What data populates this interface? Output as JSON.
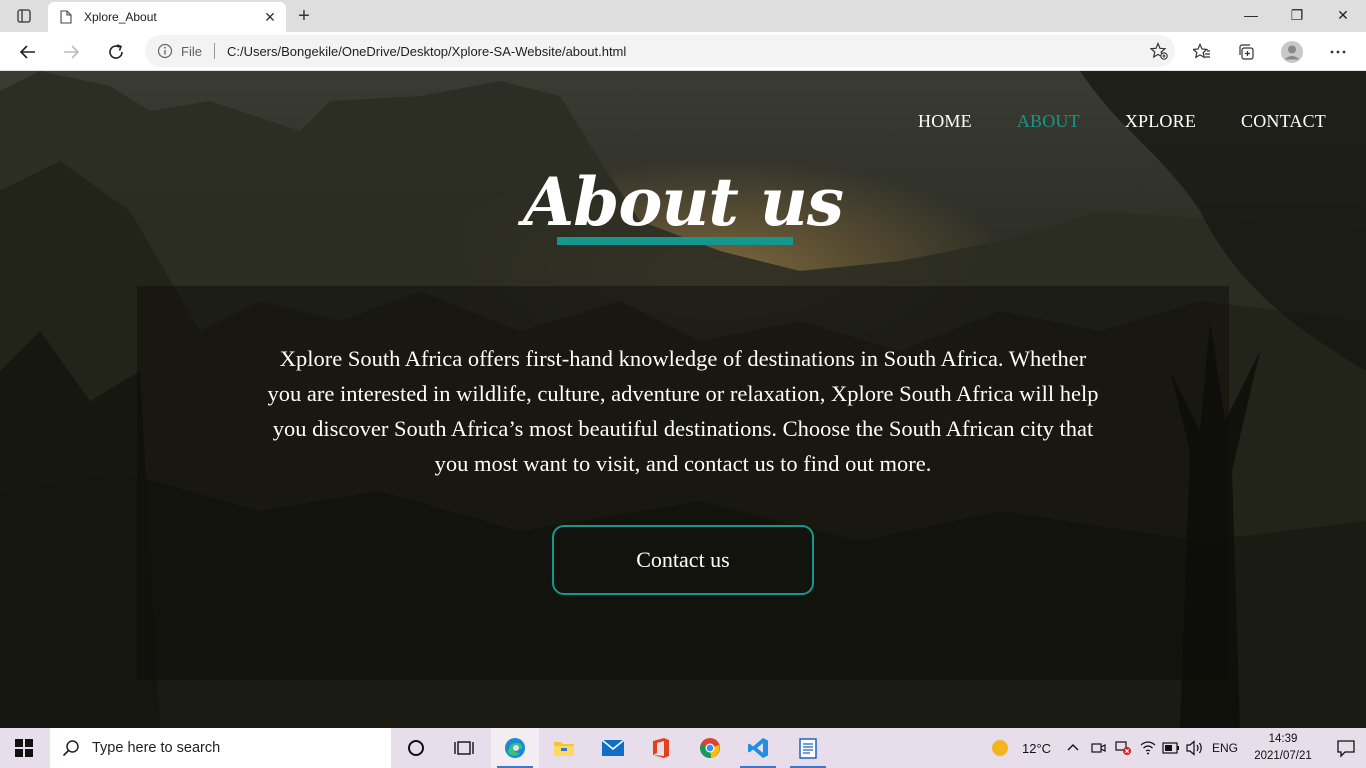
{
  "browser": {
    "tab_title": "Xplore_About",
    "tab_close": "✕",
    "new_tab": "+",
    "address_file_label": "File",
    "address_url": "C:/Users/Bongekile/OneDrive/Desktop/Xplore-SA-Website/about.html",
    "window_controls": {
      "minimize": "—",
      "restore": "❐",
      "close": "✕"
    }
  },
  "page": {
    "nav": [
      {
        "label": "HOME",
        "active": false
      },
      {
        "label": "ABOUT",
        "active": true
      },
      {
        "label": "XPLORE",
        "active": false
      },
      {
        "label": "CONTACT",
        "active": false
      }
    ],
    "heading": "About us",
    "body_text": "Xplore South Africa offers first-hand knowledge of destinations in South Africa. Whether you are interested in wildlife, culture, adventure or relaxation, Xplore South Africa will help you discover South Africa’s most beautiful destinations. Choose the South African city that you most want to visit, and contact us to find out more.",
    "contact_button": "Contact us",
    "accent_color": "#16978d"
  },
  "taskbar": {
    "search_placeholder": "Type here to search",
    "weather": "12°C",
    "language": "ENG",
    "time": "14:39",
    "date": "2021/07/21"
  }
}
